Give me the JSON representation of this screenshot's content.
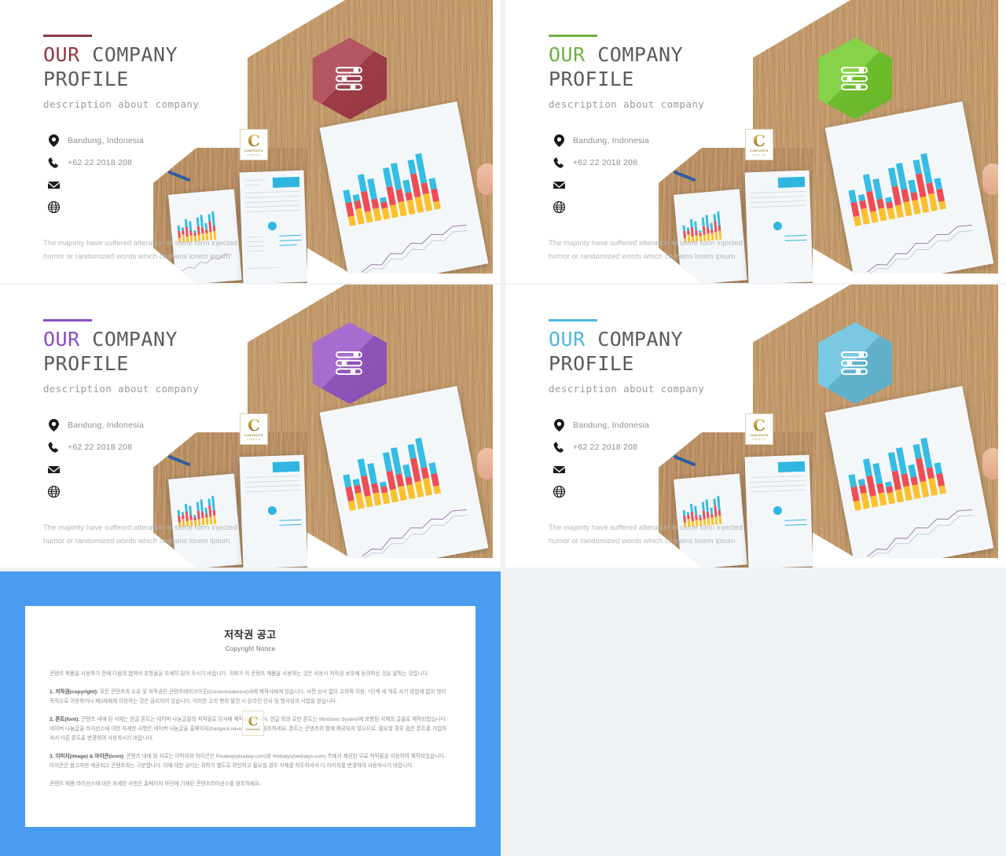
{
  "meta": {
    "background_color": "#eef2f5",
    "slide_count": 5
  },
  "slides": [
    {
      "id": "slide-red",
      "accent_color": "#8e3a45",
      "accent_hex_color": "#a8404c",
      "rule_color": "#8e3a45",
      "title_line1_highlight": "OUR",
      "title_line1_rest": "COMPANY",
      "title_line2": "PROFILE",
      "subtitle": "description about company",
      "contacts": [
        {
          "icon": "location-pin-icon",
          "text": "Bandung, Indonesia"
        },
        {
          "icon": "phone-icon",
          "text": "+62 22 2018 208"
        },
        {
          "icon": "envelope-icon",
          "text": ""
        },
        {
          "icon": "globe-icon",
          "text": ""
        }
      ],
      "paragraph": "The majority have suffered alteration in some form injected humor or randomized words which contains lorem ipsum",
      "badge_icon": "sliders-settings-icon",
      "watermark": {
        "letter": "C",
        "line1": "CONTENTS",
        "line2": "PREMIUM"
      }
    },
    {
      "id": "slide-green",
      "accent_color": "#6cb33f",
      "accent_hex_color": "#76cc2f",
      "rule_color": "#6cb33f",
      "title_line1_highlight": "OUR",
      "title_line1_rest": "COMPANY",
      "title_line2": "PROFILE",
      "subtitle": "description about company",
      "contacts": [
        {
          "icon": "location-pin-icon",
          "text": "Bandung, Indonesia"
        },
        {
          "icon": "phone-icon",
          "text": "+62 22 2018 208"
        },
        {
          "icon": "envelope-icon",
          "text": ""
        },
        {
          "icon": "globe-icon",
          "text": ""
        }
      ],
      "paragraph": "The majority have suffered alteration in some form injected humor or randomized words which contains lorem ipsum",
      "badge_icon": "sliders-settings-icon",
      "watermark": {
        "letter": "C",
        "line1": "CONTENTS",
        "line2": "PREMIUM"
      }
    },
    {
      "id": "slide-purple",
      "accent_color": "#8a4bbd",
      "accent_hex_color": "#9b59c9",
      "rule_color": "#8a4bbd",
      "title_line1_highlight": "OUR",
      "title_line1_rest": "COMPANY",
      "title_line2": "PROFILE",
      "subtitle": "description about company",
      "contacts": [
        {
          "icon": "location-pin-icon",
          "text": "Bandung, Indonesia"
        },
        {
          "icon": "phone-icon",
          "text": "+62 22 2018 208"
        },
        {
          "icon": "envelope-icon",
          "text": ""
        },
        {
          "icon": "globe-icon",
          "text": ""
        }
      ],
      "paragraph": "The majority have suffered alteration in some form injected humor or randomized words which contains lorem ipsum",
      "badge_icon": "sliders-settings-icon",
      "watermark": {
        "letter": "C",
        "line1": "CONTENTS",
        "line2": "PREMIUM"
      }
    },
    {
      "id": "slide-blue",
      "accent_color": "#4db7e0",
      "accent_hex_color": "#69c0de",
      "rule_color": "#4db7e0",
      "title_line1_highlight": "OUR",
      "title_line1_rest": "COMPANY",
      "title_line2": "PROFILE",
      "subtitle": "description about company",
      "contacts": [
        {
          "icon": "location-pin-icon",
          "text": "Bandung, Indonesia"
        },
        {
          "icon": "phone-icon",
          "text": "+62 22 2018 208"
        },
        {
          "icon": "envelope-icon",
          "text": ""
        },
        {
          "icon": "globe-icon",
          "text": ""
        }
      ],
      "paragraph": "The majority have suffered alteration in some form injected humor or randomized words which contains lorem ipsum",
      "badge_icon": "sliders-settings-icon",
      "watermark": {
        "letter": "C",
        "line1": "CONTENTS",
        "line2": "PREMIUM"
      }
    }
  ],
  "copyright_slide": {
    "border_color": "#4a9cf0",
    "title": "저작권 공고",
    "subtitle": "Copyright Notice",
    "intro": "콘텐츠 제품을 사용하기 전에 다음의 협약서 조항들을 자세히 읽어 주시기 바랍니다. 귀하가 이 콘텐츠 제품을 사용하는 것은 사용시 저작권 보호에 동의하신 것을 말하는 것입니다.",
    "sections": [
      {
        "heading": "1. 저작권(copyright):",
        "text": "모든 콘텐츠의 소유 및 저작권은 콘텐츠테이크아웃(Contentstakeout)사에 제작사에게 있습니다. 사전 승낙 없이 고의적 이용, 7단계 세 개로 사기 방법에 없이 영리 목적으로 이용하거나 제3자에게 이용하는 것은 금지되어 있습니다. 이러한 고의 행위 발견 시 온라인 민사 및 형사상의 사법을 받습니다."
      },
      {
        "heading": "2. 폰트(font):",
        "text": "콘텐츠 내에 된 서체는 한글 폰트는 네이버 나눔글꼴의 저작물로 당사에 제작되었습니다. 한글 외의 로만 폰트는 Windows System에 포함된 서체의 글꼴로 제작되었습니다. 네이버 나눔글꼴 라이선스에 대한 자세한 사항은 네이버 나눔글꼴 홈페이지(hangeul.naver.com)를 참조하세요. 폰트는 콘텐츠의 함께 제공되지 않으므로, 필요할 경우 검은 폰트를 가입하셔서 다른 폰트로 변경하여 사용하시기 바랍니다."
      },
      {
        "heading": "3. 이미지(image) & 아이콘(icon):",
        "text": "콘텐츠 내에 된 서로는 이미지와 아이콘은 Pixabay(pixabay.com)와 Webalys(webalys.com) 측에서 제공한 무료 저작물을 이용하여 제작되었습니다. 아이콘은 참고자만 제공되고 콘텐츠와는 구분합니다. 이에 대한 권리는 귀하가 별도로 확인하고 필요할 경우 삭제를 하두하셔서 다 이미지를 변경하여 사용하시기 바랍니다."
      }
    ],
    "footer": "콘텐츠 제품 라이선스에 대한 자세한 사항은 홈페이지 하단에 기재된 콘텐츠라이선스를 참조하세요.",
    "watermark": {
      "letter": "C",
      "line1": "CONTENTS"
    }
  }
}
